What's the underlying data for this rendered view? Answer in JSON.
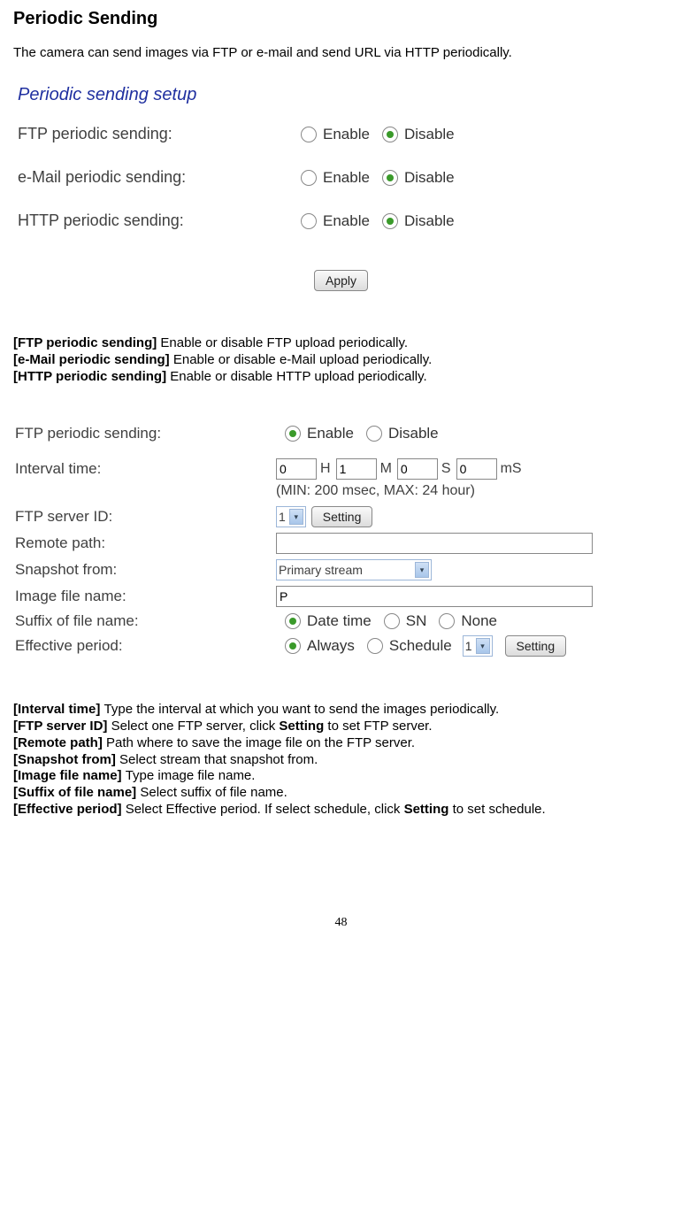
{
  "title": "Periodic Sending",
  "intro": "The camera can send images via FTP or e-mail and send URL via HTTP periodically.",
  "panel1": {
    "title": "Periodic sending setup",
    "rows": [
      {
        "label": "FTP periodic sending:",
        "enable": "Enable",
        "disable": "Disable"
      },
      {
        "label": "e-Mail periodic sending:",
        "enable": "Enable",
        "disable": "Disable"
      },
      {
        "label": "HTTP periodic sending:",
        "enable": "Enable",
        "disable": "Disable"
      }
    ],
    "apply": "Apply"
  },
  "desc1": {
    "l1b": "[FTP periodic sending] ",
    "l1t": "Enable or disable FTP upload periodically.",
    "l2b": "[e-Mail periodic sending] ",
    "l2t": "Enable or disable e-Mail upload periodically.",
    "l3b": "[HTTP periodic sending] ",
    "l3t": "Enable or disable HTTP upload periodically."
  },
  "panel2": {
    "row_ftp": {
      "label": "FTP periodic sending:",
      "enable": "Enable",
      "disable": "Disable"
    },
    "interval": {
      "label": "Interval time:",
      "h": "0",
      "hU": "H",
      "m": "1",
      "mU": "M",
      "s": "0",
      "sU": "S",
      "ms": "0",
      "msU": "mS",
      "hint": "(MIN: 200 msec, MAX: 24 hour)"
    },
    "server": {
      "label": "FTP server ID:",
      "sel": "1",
      "btn": "Setting"
    },
    "remote": {
      "label": "Remote path:",
      "val": ""
    },
    "snap": {
      "label": "Snapshot from:",
      "sel": "Primary stream"
    },
    "ifn": {
      "label": "Image file name:",
      "val": "P"
    },
    "suffix": {
      "label": "Suffix of file name:",
      "o1": "Date time",
      "o2": "SN",
      "o3": "None"
    },
    "eff": {
      "label": "Effective period:",
      "o1": "Always",
      "o2": "Schedule",
      "sel": "1",
      "btn": "Setting"
    }
  },
  "desc2": {
    "l1b": "[Interval time] ",
    "l1t": "Type the interval at which you want to send the images periodically.",
    "l2b": "[FTP server ID] ",
    "l2t1": "Select one FTP server, click ",
    "l2tb": "Setting",
    "l2t2": " to set FTP server.",
    "l3b": "[Remote path] ",
    "l3t": "Path where to save the image file on the FTP server.",
    "l4b": "[Snapshot from] ",
    "l4t": "Select stream that snapshot from.",
    "l5b": "[Image file name] ",
    "l5t": "Type image file name.",
    "l6b": "[Suffix of file name] ",
    "l6t": "Select suffix of file name.",
    "l7b": "[Effective period] ",
    "l7t1": "Select Effective period. If select  schedule, click ",
    "l7tb": "Setting",
    "l7t2": " to set schedule."
  },
  "pageNum": "48"
}
